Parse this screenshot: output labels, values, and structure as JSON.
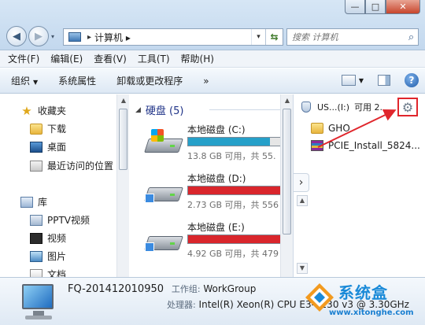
{
  "window": {
    "minimize": "—",
    "maximize": "□",
    "close": "✕"
  },
  "nav": {
    "back": "◀",
    "forward": "▶",
    "dropdown": "▾"
  },
  "address": {
    "separator": "▸",
    "path": "计算机",
    "path_separator": "▸",
    "dropdown": "▾",
    "refresh": "⇆"
  },
  "search": {
    "placeholder": "搜索 计算机",
    "icon": "search-icon"
  },
  "menu": {
    "items": [
      "文件(F)",
      "编辑(E)",
      "查看(V)",
      "工具(T)",
      "帮助(H)"
    ]
  },
  "toolbar": {
    "organize": "组织",
    "system_properties": "系统属性",
    "uninstall": "卸载或更改程序",
    "more": "»",
    "help": "?"
  },
  "navpane": {
    "favorites": "收藏夹",
    "downloads": "下载",
    "desktop": "桌面",
    "recent": "最近访问的位置",
    "libraries": "库",
    "pptv": "PPTV视频",
    "videos": "视频",
    "pictures": "图片",
    "documents": "文档"
  },
  "content": {
    "group_title": "硬盘 (5)",
    "drives": [
      {
        "name": "本地磁盘 (C:)",
        "free": "13.8 GB 可用，共 55.",
        "used_fraction": 0.75,
        "color": "#26a0c9"
      },
      {
        "name": "本地磁盘 (D:)",
        "free": "2.73 GB 可用，共 556",
        "used_fraction": 0.995,
        "color": "#d9262c"
      },
      {
        "name": "本地磁盘 (E:)",
        "free": "4.92 GB 可用，共 479",
        "used_fraction": 0.99,
        "color": "#d9262c"
      }
    ]
  },
  "preview": {
    "usb_label": "US...(I:)",
    "usb_free": "可用 2.",
    "gear": "⚙",
    "expand": "›",
    "files": [
      "GHO",
      "PCIE_Install_5824..."
    ]
  },
  "details": {
    "computer_name": "FQ-201412010950",
    "workgroup_label": "工作组:",
    "workgroup": "WorkGroup",
    "processor_label": "处理器:",
    "processor": "Intel(R) Xeon(R) CPU E3-1230 v3 @ 3.30GHz"
  },
  "watermark": {
    "name": "系统盒",
    "url": "www.xitonghe.com"
  },
  "colors": {
    "accent_red": "#e0262c",
    "drive_ok": "#26a0c9",
    "drive_full": "#d9262c",
    "group_header": "#1e3287"
  }
}
